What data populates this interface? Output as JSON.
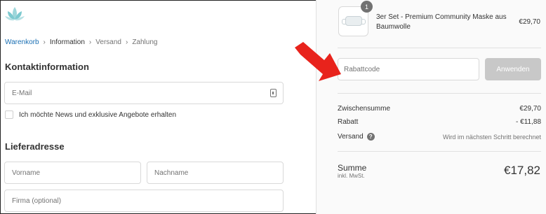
{
  "colors": {
    "accent_link": "#1a6fb3",
    "logo_teal": "#7cc9cf",
    "annotation_red": "#e8231c",
    "button_disabled": "#c8c8c8"
  },
  "logo": {
    "icon": "lotus-logo-icon"
  },
  "breadcrumb": {
    "items": [
      {
        "label": "Warenkorb"
      },
      {
        "label": "Information"
      },
      {
        "label": "Versand"
      },
      {
        "label": "Zahlung"
      }
    ]
  },
  "contact": {
    "title": "Kontaktinformation",
    "email_placeholder": "E-Mail",
    "email_icon": "contact-card-icon",
    "newsletter_label": "Ich möchte News und exklusive Angebote erhalten"
  },
  "shipping_address": {
    "title": "Lieferadresse",
    "first_name_placeholder": "Vorname",
    "last_name_placeholder": "Nachname",
    "company_placeholder": "Firma (optional)"
  },
  "order_summary": {
    "product": {
      "quantity": "1",
      "name": "3er Set - Premium Community Maske aus Baumwolle",
      "price": "€29,70"
    },
    "discount": {
      "placeholder": "Rabattcode",
      "apply_label": "Anwenden"
    },
    "subtotal": {
      "label": "Zwischensumme",
      "value": "€29,70"
    },
    "rebate": {
      "label": "Rabatt",
      "value": "- €11,88"
    },
    "shipping": {
      "label": "Versand",
      "value": "Wird im nächsten Schritt berechnet",
      "help_icon": "?"
    },
    "total": {
      "label": "Summe",
      "sub": "inkl. MwSt.",
      "value": "€17,82"
    }
  },
  "annotation": {
    "icon": "red-arrow-icon"
  }
}
